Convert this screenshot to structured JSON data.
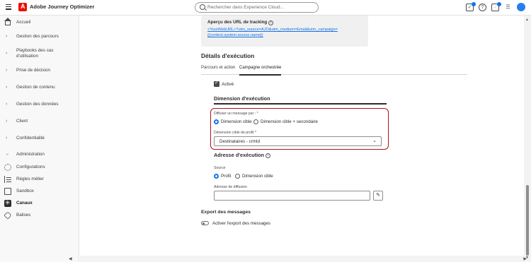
{
  "app": {
    "title": "Adobe Journey Optimizer"
  },
  "search": {
    "placeholder": "Rechercher dans Experience Cloud..."
  },
  "sidebar": {
    "items": [
      {
        "label": "Accueil",
        "icon": "home-icon"
      },
      {
        "label": "Gestion des parcours",
        "icon": "chevron-right-icon"
      },
      {
        "label": "Playbooks des cas d'utilisation",
        "icon": "chevron-right-icon"
      },
      {
        "label": "Prise de décision",
        "icon": "chevron-right-icon"
      },
      {
        "label": "Gestion de contenu",
        "icon": "chevron-right-icon"
      },
      {
        "label": "Gestion des données",
        "icon": "chevron-right-icon"
      },
      {
        "label": "Client",
        "icon": "chevron-right-icon"
      },
      {
        "label": "Confidentialité",
        "icon": "chevron-right-icon"
      },
      {
        "label": "Administration",
        "icon": "chevron-down-icon"
      },
      {
        "label": "Configurations",
        "icon": "gear-icon"
      },
      {
        "label": "Règles métier",
        "icon": "rules-icon"
      },
      {
        "label": "Sandbox",
        "icon": "box-icon"
      },
      {
        "label": "Canaux",
        "icon": "channels-icon"
      },
      {
        "label": "Balises",
        "icon": "tag-icon"
      }
    ]
  },
  "preview": {
    "title": "Aperçu des URL de tracking",
    "link_line1": "<YourWebURL>?utm_source=AJO&utm_medium=Email&utm_campaign=",
    "link_line2": "{{context.system.source.name}}"
  },
  "execution": {
    "heading": "Détails d'exécution",
    "tabs": [
      "Parcours et action",
      "Campagne orchestrée"
    ],
    "active_label": "Activé",
    "dimension_heading": "Dimension d'exécution",
    "diffuse_label": "Diffuser un message par : *",
    "radio_options": [
      "Dimension cible",
      "Dimension cible + secondaire"
    ],
    "profile_dimension_label": "Dimension cible de profil *",
    "profile_dimension_value": "Destinataires - crmId",
    "address_heading": "Adresse d'exécution",
    "source_label": "Source",
    "source_options": [
      "Profil",
      "Dimension cible"
    ],
    "delivery_address_label": "Adresse de diffusion",
    "delivery_address_value": ""
  },
  "export": {
    "heading": "Export des messages",
    "toggle_label": "Activer l'export des messages"
  }
}
